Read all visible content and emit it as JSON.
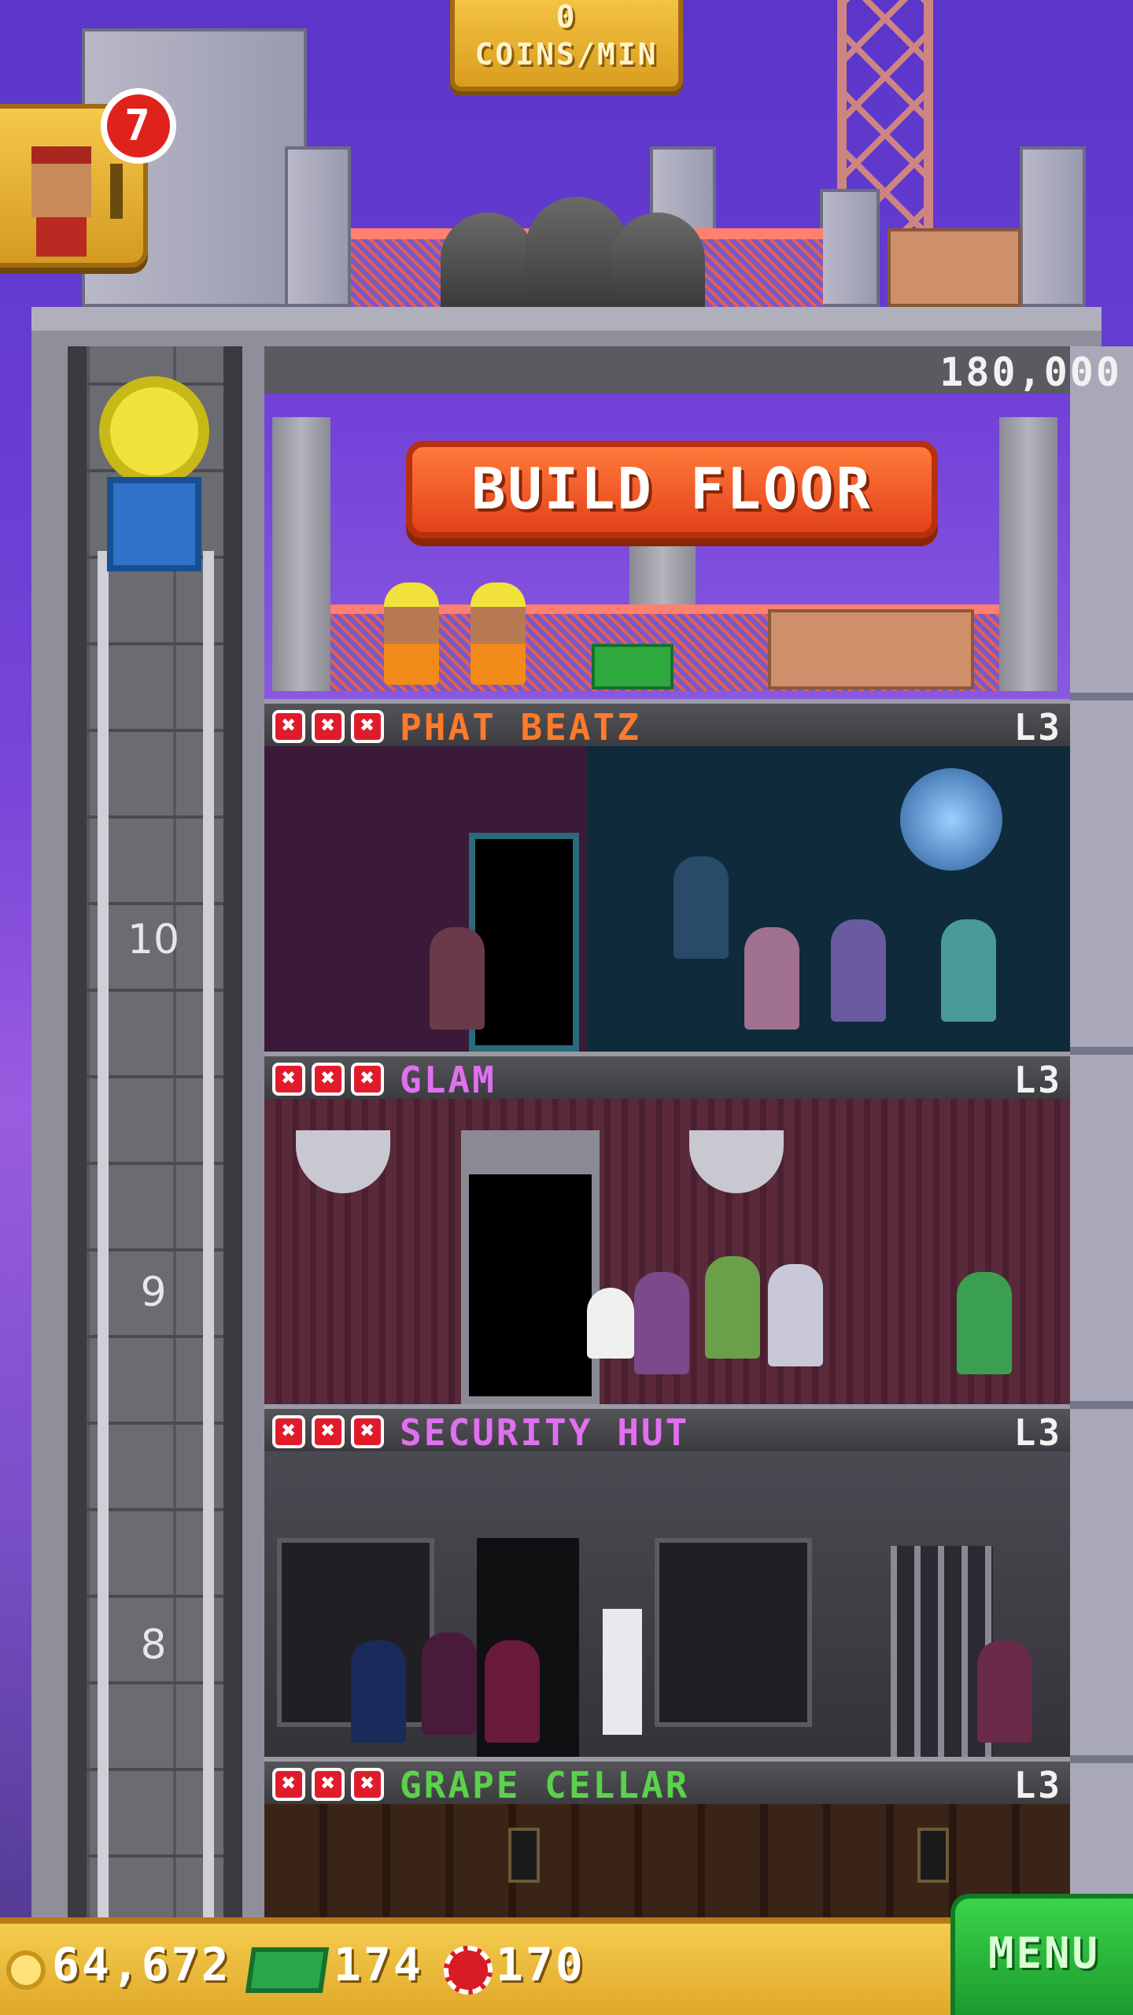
{
  "hud_top": {
    "coins_per_min_value": "0",
    "coins_per_min_label": "COINS/MIN"
  },
  "notifications": {
    "bellhop_badge": "7"
  },
  "build": {
    "cost": "180,000",
    "button_label": "BUILD FLOOR"
  },
  "floors": [
    {
      "name": "PHAT BEATZ",
      "level": "L3",
      "name_color": "#ff7a2a",
      "stars_filled": 3,
      "room_color": "#142a38"
    },
    {
      "name": "GLAM",
      "level": "L3",
      "name_color": "#e070f0",
      "stars_filled": 3,
      "room_color": "#5a2a3a"
    },
    {
      "name": "SECURITY HUT",
      "level": "L3",
      "name_color": "#e070f0",
      "stars_filled": 3,
      "room_color": "#3e3e46"
    },
    {
      "name": "GRAPE CELLAR",
      "level": "L3",
      "name_color": "#5ad24a",
      "stars_filled": 3,
      "room_color": "#3a2418"
    }
  ],
  "elevator_floor_numbers": [
    "10",
    "9",
    "8"
  ],
  "resources": {
    "coins": "64,672",
    "tower_bux": "174",
    "chips": "170"
  },
  "menu": {
    "label": "MENU"
  },
  "icons": [
    "coin-icon",
    "tower-bux-icon",
    "poker-chip-icon",
    "star-icon",
    "elevator-icon",
    "bellhop-icon"
  ]
}
